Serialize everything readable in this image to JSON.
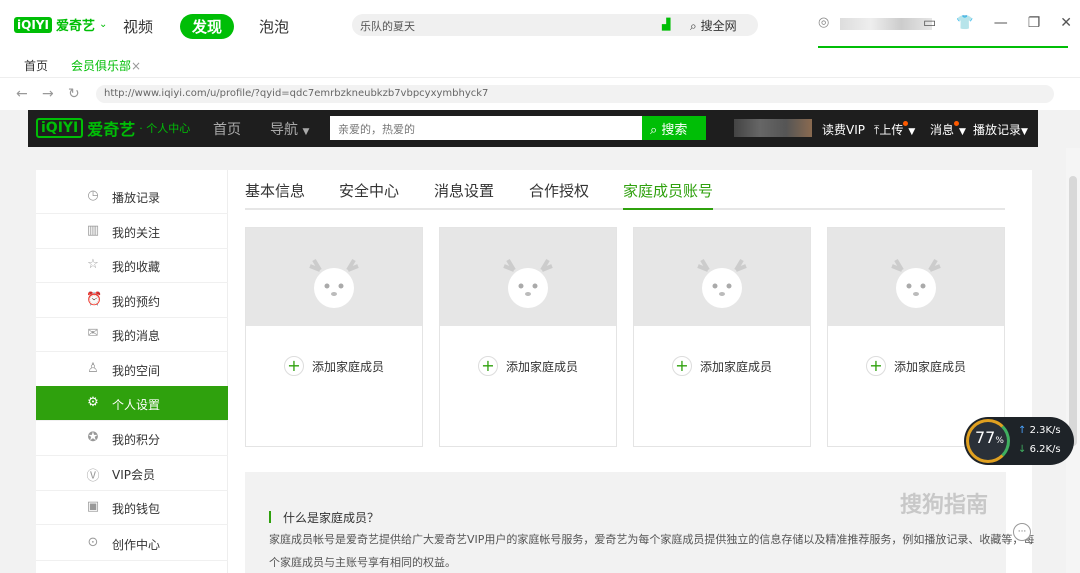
{
  "app": {
    "logo": "iQIYI",
    "brand": "爱奇艺",
    "nav": [
      {
        "label": "视频",
        "active": false
      },
      {
        "label": "发现",
        "active": true
      },
      {
        "label": "泡泡",
        "active": false
      }
    ],
    "search_value": "乐队的夏天",
    "search_button": "搜全网"
  },
  "browser": {
    "tabs": [
      "首页",
      "会员俱乐部"
    ],
    "tab_close": "×",
    "url": "http://www.iqiyi.com/u/profile/?qyid=qdc7emrbzkneubkzb7vbpcyxymbhyck7"
  },
  "site_header": {
    "logo": "iQIYI",
    "brand": "爱奇艺",
    "subtitle": "· 个人中心",
    "home": "首页",
    "nav": "导航",
    "search_placeholder": "亲爱的，热爱的",
    "search_button": "搜索",
    "vip": "读费VIP",
    "upload": "上传",
    "message": "消息",
    "history": "播放记录"
  },
  "sidebar": {
    "items": [
      {
        "label": "播放记录",
        "icon": "clock-icon",
        "active": false
      },
      {
        "label": "我的关注",
        "icon": "book-icon",
        "active": false
      },
      {
        "label": "我的收藏",
        "icon": "star-icon",
        "active": false
      },
      {
        "label": "我的预约",
        "icon": "alarm-icon",
        "active": false
      },
      {
        "label": "我的消息",
        "icon": "mail-icon",
        "active": false
      },
      {
        "label": "我的空间",
        "icon": "person-icon",
        "active": false
      },
      {
        "label": "个人设置",
        "icon": "gear-icon",
        "active": true
      },
      {
        "label": "我的积分",
        "icon": "medal-icon",
        "active": false
      },
      {
        "label": "VIP会员",
        "icon": "vip-icon",
        "active": false
      },
      {
        "label": "我的钱包",
        "icon": "wallet-icon",
        "active": false
      },
      {
        "label": "创作中心",
        "icon": "badge-icon",
        "active": false
      }
    ]
  },
  "profile_tabs": [
    {
      "label": "基本信息",
      "active": false
    },
    {
      "label": "安全中心",
      "active": false
    },
    {
      "label": "消息设置",
      "active": false
    },
    {
      "label": "合作授权",
      "active": false
    },
    {
      "label": "家庭成员账号",
      "active": true
    }
  ],
  "family_cards": [
    {
      "add_label": "添加家庭成员"
    },
    {
      "add_label": "添加家庭成员"
    },
    {
      "add_label": "添加家庭成员"
    },
    {
      "add_label": "添加家庭成员"
    }
  ],
  "info": {
    "question": "什么是家庭成员？",
    "line1": "家庭成员帐号是爱奇艺提供给广大爱奇艺VIP用户的家庭帐号服务，爱奇艺为每个家庭成员提供独立的信息存储以及精准推荐服务，例如播放记录、收藏等，每",
    "line2": "个家庭成员与主账号享有相同的权益。"
  },
  "widget": {
    "percent": "77",
    "percent_unit": "%",
    "upload": "2.3K/s",
    "download": "6.2K/s"
  },
  "watermark": "搜狗指南",
  "colors": {
    "brand_green": "#00be06",
    "active_green": "#2fa10d",
    "header_dark": "#1e1e1e"
  }
}
